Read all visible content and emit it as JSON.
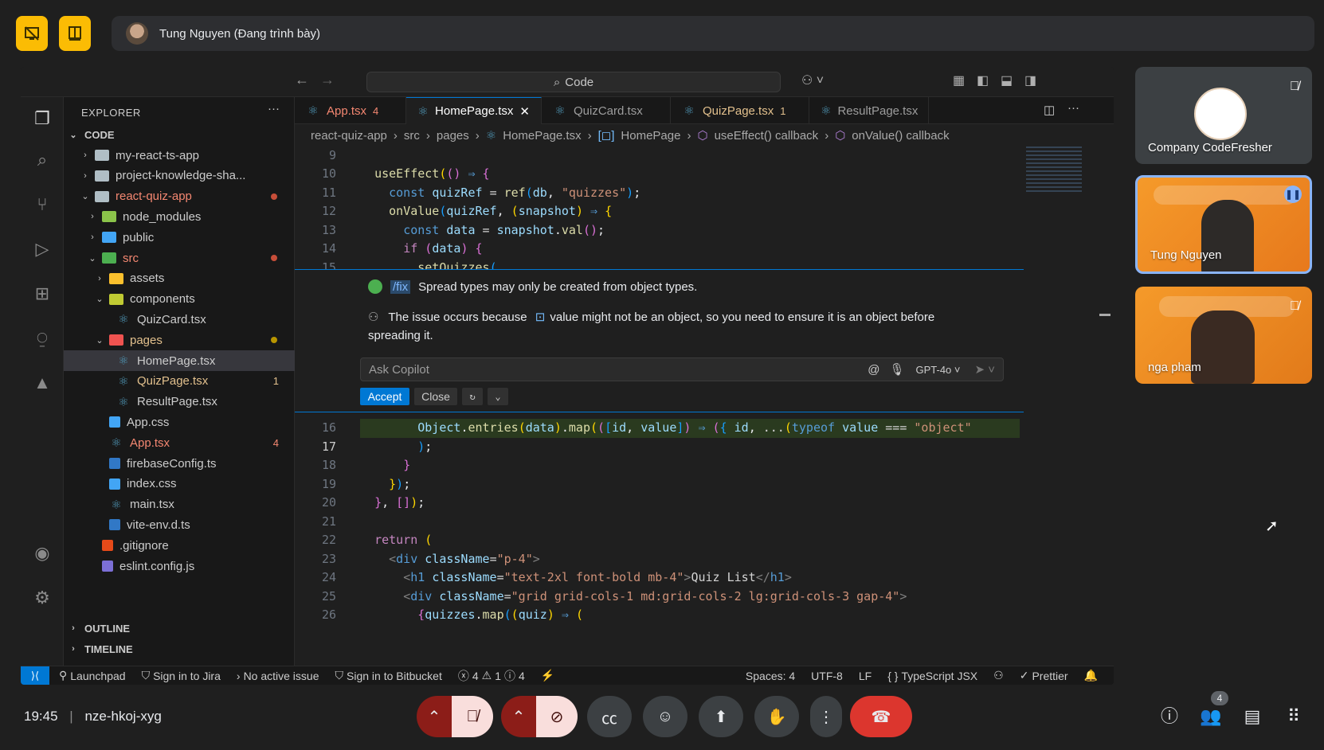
{
  "meet": {
    "presenter_label": "Tung Nguyen (Đang trình bày)",
    "meeting_time": "19:45",
    "meeting_code": "nze-hkoj-xyg",
    "participants_count": "4",
    "tiles": [
      {
        "name": "Company CodeFresher",
        "muted": true
      },
      {
        "name": "Tung Nguyen",
        "speaking": true
      },
      {
        "name": "nga pham",
        "muted": true
      }
    ]
  },
  "vscode": {
    "search_text": "Code",
    "explorer_title": "EXPLORER",
    "explorer_section": "CODE",
    "tree": [
      {
        "label": "my-react-ts-app",
        "type": "folder",
        "depth": 1,
        "open": false
      },
      {
        "label": "project-knowledge-sha...",
        "type": "folder",
        "depth": 1,
        "open": false
      },
      {
        "label": "react-quiz-app",
        "type": "folder",
        "depth": 1,
        "open": true,
        "status": "red"
      },
      {
        "label": "node_modules",
        "type": "folder",
        "depth": 2,
        "open": false
      },
      {
        "label": "public",
        "type": "folder",
        "depth": 2,
        "open": false
      },
      {
        "label": "src",
        "type": "folder",
        "depth": 2,
        "open": true,
        "status": "red"
      },
      {
        "label": "assets",
        "type": "folder",
        "depth": 3,
        "open": false
      },
      {
        "label": "components",
        "type": "folder",
        "depth": 3,
        "open": true
      },
      {
        "label": "QuizCard.tsx",
        "type": "react",
        "depth": 4
      },
      {
        "label": "pages",
        "type": "folder",
        "depth": 3,
        "open": true,
        "status": "modified"
      },
      {
        "label": "HomePage.tsx",
        "type": "react",
        "depth": 4,
        "selected": true
      },
      {
        "label": "QuizPage.tsx",
        "type": "react",
        "depth": 4,
        "status": "modified",
        "badge": "1"
      },
      {
        "label": "ResultPage.tsx",
        "type": "react",
        "depth": 4
      },
      {
        "label": "App.css",
        "type": "css",
        "depth": 3
      },
      {
        "label": "App.tsx",
        "type": "react",
        "depth": 3,
        "status": "red",
        "badge": "4"
      },
      {
        "label": "firebaseConfig.ts",
        "type": "ts",
        "depth": 3
      },
      {
        "label": "index.css",
        "type": "css",
        "depth": 3
      },
      {
        "label": "main.tsx",
        "type": "react",
        "depth": 3
      },
      {
        "label": "vite-env.d.ts",
        "type": "ts",
        "depth": 3
      },
      {
        "label": ".gitignore",
        "type": "git",
        "depth": 2
      },
      {
        "label": "eslint.config.js",
        "type": "eslint",
        "depth": 2
      }
    ],
    "outline_label": "OUTLINE",
    "timeline_label": "TIMELINE",
    "tabs": [
      {
        "label": "App.tsx",
        "badge": "4",
        "status": "red"
      },
      {
        "label": "HomePage.tsx",
        "active": true
      },
      {
        "label": "QuizCard.tsx"
      },
      {
        "label": "QuizPage.tsx",
        "badge": "1",
        "status": "modified"
      },
      {
        "label": "ResultPage.tsx"
      }
    ],
    "breadcrumbs": [
      "react-quiz-app",
      "src",
      "pages",
      "HomePage.tsx",
      "HomePage",
      "useEffect() callback",
      "onValue() callback"
    ],
    "copilot": {
      "fix_tag": "/fix",
      "fix_text": "Spread types may only be created from object types.",
      "explain_before": "The issue occurs because",
      "explain_symbol": "value",
      "explain_after": "might not be an object, so you need to ensure it is an object before",
      "explain_line2": "spreading it.",
      "ask_placeholder": "Ask Copilot",
      "model": "GPT-4o",
      "accept_label": "Accept",
      "close_label": "Close"
    },
    "status_bar": {
      "launchpad": "Launchpad",
      "jira": "Sign in to Jira",
      "issue": "No active issue",
      "bitbucket": "Sign in to Bitbucket",
      "errors": "4",
      "warnings": "1",
      "infos": "4",
      "spaces": "Spaces: 4",
      "encoding": "UTF-8",
      "eol": "LF",
      "language": "TypeScript JSX",
      "formatter": "Prettier"
    }
  }
}
